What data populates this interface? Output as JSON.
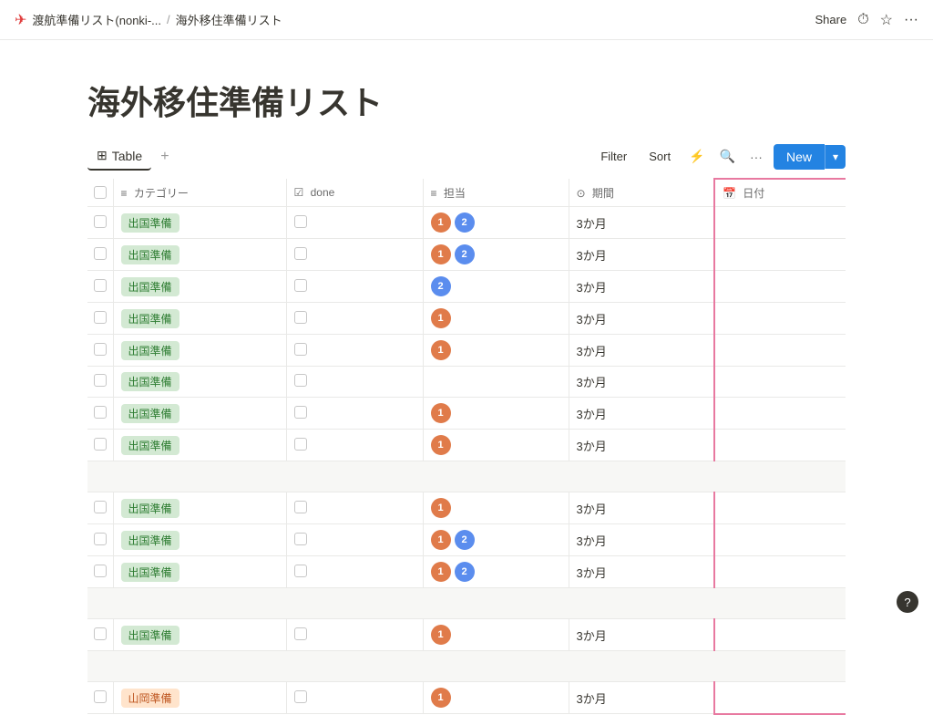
{
  "nav": {
    "icon": "✈",
    "breadcrumb1": "渡航準備リスト(nonki-...",
    "sep": "/",
    "breadcrumb2": "海外移住準備リスト",
    "share": "Share",
    "more": "···"
  },
  "page": {
    "title": "海外移住準備リスト"
  },
  "toolbar": {
    "tab_icon": "⊞",
    "tab_label": "Table",
    "add_tab": "+",
    "filter": "Filter",
    "sort": "Sort",
    "lightning": "⚡",
    "search": "🔍",
    "more": "···",
    "new_label": "New",
    "new_arrow": "▾"
  },
  "table": {
    "headers": [
      {
        "key": "check",
        "label": "",
        "icon": ""
      },
      {
        "key": "category",
        "label": "カテゴリー",
        "icon": "≡"
      },
      {
        "key": "done",
        "label": "done",
        "icon": "☑"
      },
      {
        "key": "assignee",
        "label": "担当",
        "icon": "≡"
      },
      {
        "key": "period",
        "label": "期間",
        "icon": "⊙"
      },
      {
        "key": "date",
        "label": "日付",
        "icon": "📅"
      },
      {
        "key": "add",
        "label": "+",
        "icon": ""
      }
    ],
    "groups": [
      {
        "label": "",
        "rows": [
          {
            "category": "出国準備",
            "catType": "green",
            "done": false,
            "assignees": [
              {
                "label": "1",
                "color": "orange"
              },
              {
                "label": "2",
                "color": "blue"
              }
            ],
            "period": "3か月",
            "date": ""
          },
          {
            "category": "出国準備",
            "catType": "green",
            "done": false,
            "assignees": [
              {
                "label": "1",
                "color": "orange"
              },
              {
                "label": "2",
                "color": "blue"
              }
            ],
            "period": "3か月",
            "date": ""
          },
          {
            "category": "出国準備",
            "catType": "green",
            "done": false,
            "assignees": [
              {
                "label": "2",
                "color": "blue"
              }
            ],
            "period": "3か月",
            "date": ""
          },
          {
            "category": "出国準備",
            "catType": "green",
            "done": false,
            "assignees": [
              {
                "label": "1",
                "color": "orange"
              }
            ],
            "period": "3か月",
            "date": ""
          },
          {
            "category": "出国準備",
            "catType": "green",
            "done": false,
            "assignees": [
              {
                "label": "1",
                "color": "orange"
              }
            ],
            "period": "3か月",
            "date": ""
          },
          {
            "category": "出国準備",
            "catType": "green",
            "done": false,
            "assignees": [],
            "period": "3か月",
            "date": ""
          },
          {
            "category": "出国準備",
            "catType": "green",
            "done": false,
            "assignees": [
              {
                "label": "1",
                "color": "orange"
              }
            ],
            "period": "3か月",
            "date": ""
          },
          {
            "category": "出国準備",
            "catType": "green",
            "done": false,
            "assignees": [
              {
                "label": "1",
                "color": "orange"
              }
            ],
            "period": "3か月",
            "date": ""
          }
        ]
      },
      {
        "label": "",
        "rows": [
          {
            "category": "出国準備",
            "catType": "green",
            "done": false,
            "assignees": [
              {
                "label": "1",
                "color": "orange"
              }
            ],
            "period": "3か月",
            "date": ""
          },
          {
            "category": "出国準備",
            "catType": "green",
            "done": false,
            "assignees": [
              {
                "label": "1",
                "color": "orange"
              },
              {
                "label": "2",
                "color": "blue"
              }
            ],
            "period": "3か月",
            "date": ""
          },
          {
            "category": "出国準備",
            "catType": "green",
            "done": false,
            "assignees": [
              {
                "label": "1",
                "color": "orange"
              },
              {
                "label": "2",
                "color": "blue"
              }
            ],
            "period": "3か月",
            "date": ""
          }
        ]
      },
      {
        "label": "",
        "rows": [
          {
            "category": "出国準備",
            "catType": "green",
            "done": false,
            "assignees": [
              {
                "label": "1",
                "color": "orange"
              }
            ],
            "period": "3か月",
            "date": ""
          }
        ]
      },
      {
        "label": "",
        "rows": [
          {
            "category": "山岡準備",
            "catType": "orange",
            "done": false,
            "assignees": [
              {
                "label": "1",
                "color": "orange"
              }
            ],
            "period": "3か月",
            "date": ""
          }
        ]
      }
    ]
  },
  "bottom": {
    "help": "?"
  }
}
